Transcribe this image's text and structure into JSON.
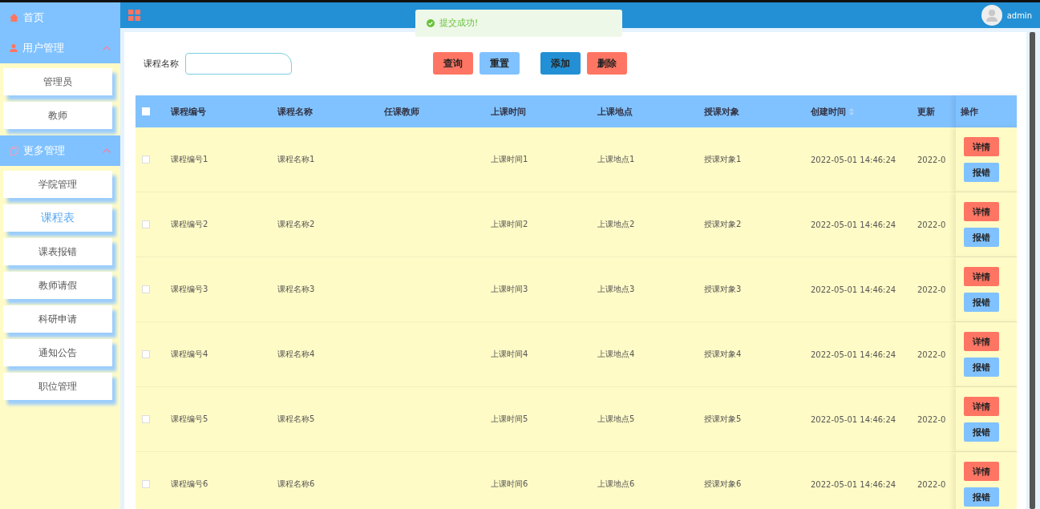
{
  "sidebar": {
    "items": [
      {
        "label": "首页",
        "kind": "link"
      },
      {
        "label": "用户管理",
        "kind": "group",
        "expanded": true,
        "children": [
          {
            "label": "管理员",
            "selected": false
          },
          {
            "label": "教师",
            "selected": false
          }
        ]
      },
      {
        "label": "更多管理",
        "kind": "group",
        "expanded": true,
        "children": [
          {
            "label": "学院管理",
            "selected": false
          },
          {
            "label": "课程表",
            "selected": true
          },
          {
            "label": "课表报错",
            "selected": false
          },
          {
            "label": "教师请假",
            "selected": false
          },
          {
            "label": "科研申请",
            "selected": false
          },
          {
            "label": "通知公告",
            "selected": false
          },
          {
            "label": "职位管理",
            "selected": false
          }
        ]
      }
    ]
  },
  "header": {
    "user": "admin"
  },
  "toast": {
    "message": "提交成功!"
  },
  "search": {
    "label": "课程名称"
  },
  "buttons": [
    {
      "label": "查询",
      "kind": "danger"
    },
    {
      "label": "重置",
      "kind": "light"
    },
    {
      "label": "添加",
      "kind": "primary"
    },
    {
      "label": "删除",
      "kind": "danger"
    }
  ],
  "table": {
    "all_checked": false,
    "columns": [
      {
        "label": "课程编号",
        "sortable": false
      },
      {
        "label": "课程名称",
        "sortable": false
      },
      {
        "label": "任课教师",
        "sortable": false
      },
      {
        "label": "上课时间",
        "sortable": false
      },
      {
        "label": "上课地点",
        "sortable": false
      },
      {
        "label": "授课对象",
        "sortable": false
      },
      {
        "label": "创建时间",
        "sortable": true
      },
      {
        "label": "更新",
        "sortable": false
      }
    ],
    "action_column": "操作",
    "rows": [
      {
        "checked": false,
        "cells": [
          "课程编号1",
          "课程名称1",
          "",
          "上课时间1",
          "上课地点1",
          "授课对象1",
          "2022-05-01 14:46:24",
          "2022-0"
        ],
        "actions": [
          "详情",
          "报错"
        ]
      },
      {
        "checked": false,
        "cells": [
          "课程编号2",
          "课程名称2",
          "",
          "上课时间2",
          "上课地点2",
          "授课对象2",
          "2022-05-01 14:46:24",
          "2022-0"
        ],
        "actions": [
          "详情",
          "报错"
        ]
      },
      {
        "checked": false,
        "cells": [
          "课程编号3",
          "课程名称3",
          "",
          "上课时间3",
          "上课地点3",
          "授课对象3",
          "2022-05-01 14:46:24",
          "2022-0"
        ],
        "actions": [
          "详情",
          "报错"
        ]
      },
      {
        "checked": false,
        "cells": [
          "课程编号4",
          "课程名称4",
          "",
          "上课时间4",
          "上课地点4",
          "授课对象4",
          "2022-05-01 14:46:24",
          "2022-0"
        ],
        "actions": [
          "详情",
          "报错"
        ]
      },
      {
        "checked": false,
        "cells": [
          "课程编号5",
          "课程名称5",
          "",
          "上课时间5",
          "上课地点5",
          "授课对象5",
          "2022-05-01 14:46:24",
          "2022-0"
        ],
        "actions": [
          "详情",
          "报错"
        ]
      },
      {
        "checked": false,
        "cells": [
          "课程编号6",
          "课程名称6",
          "",
          "上课时间6",
          "上课地点6",
          "授课对象6",
          "2022-05-01 14:46:24",
          "2022-0"
        ],
        "actions": [
          "详情",
          "报错"
        ]
      }
    ]
  }
}
